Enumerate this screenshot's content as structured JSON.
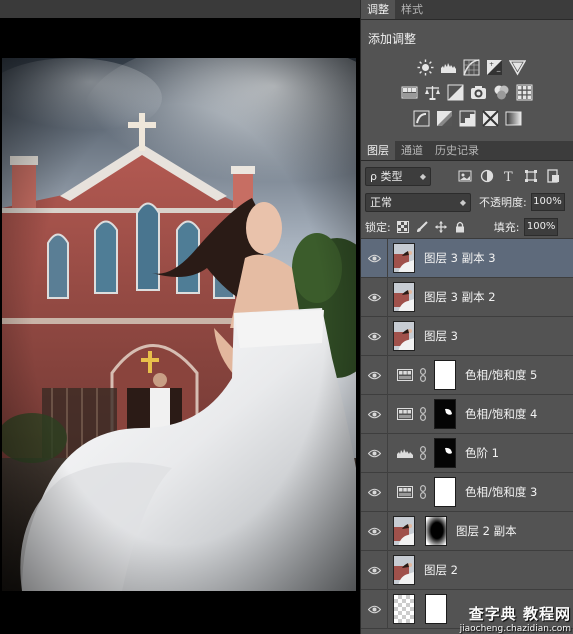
{
  "panel_tabs": [
    {
      "label": "调整",
      "active": true
    },
    {
      "label": "样式",
      "active": false
    }
  ],
  "adjustments": {
    "title": "添加调整",
    "row1_icons": [
      "brightness-icon",
      "levels-icon",
      "curves-icon",
      "exposure-icon",
      "vibrance-icon"
    ],
    "row2_icons": [
      "hue-saturation-icon",
      "color-balance-icon",
      "black-white-icon",
      "photo-filter-icon",
      "channel-mixer-icon",
      "color-lookup-icon"
    ],
    "row3_icons": [
      "invert-icon",
      "posterize-icon",
      "threshold-icon",
      "selective-color-icon",
      "gradient-map-icon"
    ]
  },
  "layers_tabs": [
    {
      "label": "图层",
      "active": true
    },
    {
      "label": "通道",
      "active": false
    },
    {
      "label": "历史记录",
      "active": false
    }
  ],
  "filter": {
    "kind_label": "ρ 类型",
    "icons": [
      "pixel-filter-icon",
      "adjustment-filter-icon",
      "type-filter-icon",
      "shape-filter-icon",
      "smart-object-filter-icon"
    ]
  },
  "blend": {
    "mode": "正常",
    "opacity_label": "不透明度:",
    "opacity": "100%"
  },
  "lock": {
    "label": "锁定:",
    "fill_label": "填充:",
    "fill": "100%"
  },
  "layers": [
    {
      "name": "图层 3 副本 3",
      "type": "photo",
      "selected": true,
      "mask": null
    },
    {
      "name": "图层 3 副本 2",
      "type": "photo",
      "selected": false,
      "mask": null
    },
    {
      "name": "图层 3",
      "type": "photo",
      "selected": false,
      "mask": null
    },
    {
      "name": "色相/饱和度 5",
      "type": "hue-sat",
      "selected": false,
      "mask": "white"
    },
    {
      "name": "色相/饱和度 4",
      "type": "hue-sat",
      "selected": false,
      "mask": "dark"
    },
    {
      "name": "色阶 1",
      "type": "levels",
      "selected": false,
      "mask": "dark"
    },
    {
      "name": "色相/饱和度 3",
      "type": "hue-sat",
      "selected": false,
      "mask": "white"
    },
    {
      "name": "图层 2 副本",
      "type": "photo-mask",
      "selected": false,
      "mask": "vignette"
    },
    {
      "name": "图层 2",
      "type": "photo",
      "selected": false,
      "mask": null
    },
    {
      "name": "",
      "type": "transparent",
      "selected": false,
      "mask": "white"
    }
  ],
  "watermark": {
    "line1": "查字典 教程网",
    "line2": "jiaocheng.chazidian.com"
  },
  "colors": {
    "selected_row": "#5e6a7b",
    "panel_bg": "#535353",
    "sky": "#cfd6de",
    "brick": "#a0514b"
  }
}
